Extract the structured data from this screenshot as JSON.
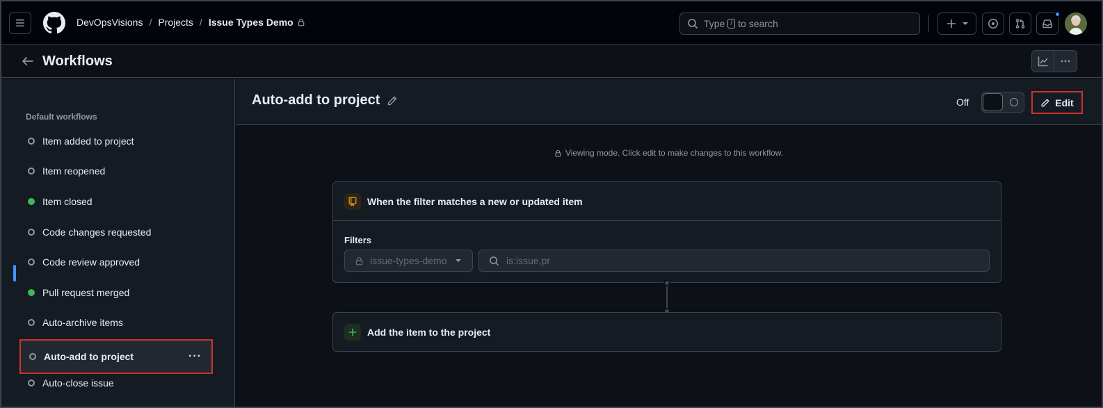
{
  "header": {
    "breadcrumb": {
      "owner": "DevOpsVisions",
      "section": "Projects",
      "project": "Issue Types Demo",
      "separator": "/"
    },
    "search": {
      "prefix": "Type",
      "key": "/",
      "suffix": "to search"
    },
    "notification_dot_color": "#4493f8"
  },
  "subheader": {
    "title": "Workflows"
  },
  "sidebar": {
    "heading": "Default workflows",
    "items": [
      {
        "label": "Item added to project",
        "enabled": false
      },
      {
        "label": "Item reopened",
        "enabled": false
      },
      {
        "label": "Item closed",
        "enabled": true
      },
      {
        "label": "Code changes requested",
        "enabled": false
      },
      {
        "label": "Code review approved",
        "enabled": false
      },
      {
        "label": "Pull request merged",
        "enabled": true
      },
      {
        "label": "Auto-archive items",
        "enabled": false
      },
      {
        "label": "Auto-add to project",
        "enabled": false,
        "active": true
      },
      {
        "label": "Auto-close issue",
        "enabled": false
      }
    ],
    "more_label": "···"
  },
  "workflow": {
    "title": "Auto-add to project",
    "status_label": "Off",
    "edit_label": "Edit",
    "viewing_note": "Viewing mode. Click edit to make changes to this workflow.",
    "trigger": {
      "title": "When the filter matches a new or updated item",
      "filters_label": "Filters",
      "repository": "issue-types-demo",
      "query": "is:issue,pr"
    },
    "action": {
      "title": "Add the item to the project"
    }
  },
  "colors": {
    "enabled_status": "#3fb950",
    "highlight_border": "#d0312d",
    "active_indicator": "#4493f8"
  }
}
